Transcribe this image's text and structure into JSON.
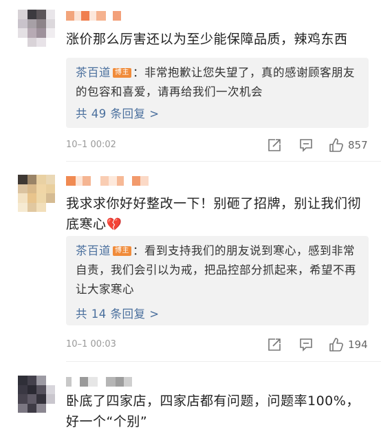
{
  "comments": [
    {
      "text": "涨价那么厉害还以为至少能保障品质，辣鸡东西",
      "reply": {
        "author": "茶百道",
        "badge": "博主",
        "text": "：非常抱歉让您失望了，真的感谢顾客朋友的包容和喜爱，请再给我们一次机会",
        "more": "共 49 条回复 >"
      },
      "time": "10–1 00:02",
      "likes": "857"
    },
    {
      "text": "我求求你好好整改一下！别砸了招牌，别让我们彻底寒心",
      "emoji": "💔",
      "reply": {
        "author": "茶百道",
        "badge": "博主",
        "text": "：看到支持我们的朋友说到寒心，感到非常自责，我们会引以为戒，把品控部分抓起来，希望不再让大家寒心",
        "more": "共 14 条回复 >"
      },
      "time": "10–1 00:03",
      "likes": "194"
    },
    {
      "text": "卧底了四家店，四家店都有问题，问题率100%，好一个“个别”"
    }
  ],
  "icons": {
    "share": "share-icon",
    "comment": "comment-icon",
    "like": "thumbs-up-icon"
  },
  "colors": {
    "link": "#4a6f9d",
    "badge": "#f08b3a",
    "reply_bg": "#f2f2f2",
    "meta": "#999999"
  }
}
